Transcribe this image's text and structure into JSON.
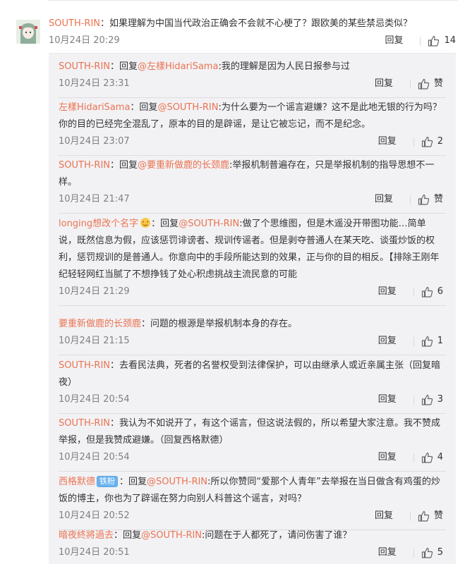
{
  "main_comment": {
    "user": "SOUTH-RIN",
    "text": "：如果理解为中国当代政治正确会不会就不心梗了？跟欧美的某些禁忌类似？",
    "time": "10月24日 20:29",
    "reply_label": "回复",
    "likes": "14"
  },
  "replies": [
    {
      "segments": [
        {
          "t": "SOUTH-RIN",
          "c": "user"
        },
        {
          "t": "：回复",
          "c": "text"
        },
        {
          "t": "@左樣HidariSama",
          "c": "user"
        },
        {
          "t": ":我的理解是因为人民日报参与过",
          "c": "text"
        }
      ],
      "time": "10月24日 23:31",
      "reply_label": "回复",
      "likes": "赞"
    },
    {
      "segments": [
        {
          "t": "左樣HidariSama",
          "c": "user"
        },
        {
          "t": "：回复",
          "c": "text"
        },
        {
          "t": "@SOUTH-RIN",
          "c": "user"
        },
        {
          "t": ":为什么要为一个谣言避嫌？这不是此地无银的行为吗？你的目的已经完全混乱了，原本的目的是辟谣，是让它被忘记，而不是纪念。",
          "c": "text"
        }
      ],
      "time": "10月24日 23:07",
      "reply_label": "回复",
      "likes": "2"
    },
    {
      "segments": [
        {
          "t": "SOUTH-RIN",
          "c": "user"
        },
        {
          "t": "：回复",
          "c": "text"
        },
        {
          "t": "@要重新做鹿的长颈鹿",
          "c": "user"
        },
        {
          "t": ":举报机制普遍存在，只是举报机制的指导思想不一样。",
          "c": "text"
        }
      ],
      "time": "10月24日 21:47",
      "reply_label": "回复",
      "likes": "赞"
    },
    {
      "segments": [
        {
          "t": "longing想改个名字",
          "c": "user"
        },
        {
          "t": "",
          "c": "emoji"
        },
        {
          "t": "：回复",
          "c": "text"
        },
        {
          "t": "@SOUTH-RIN",
          "c": "user"
        },
        {
          "t": ":做了个思维图，但是木遥没开带图功能…简单说，既然信息为假，应该惩罚诽谤者、规训传谣者。但是剥夺普通人在某天吃、谈蛋炒饭的权利，惩罚规训的是普通人。你意向中的手段所能达到的效果，正与你的目的相反。【排除王刚年纪轻轻网红当腻了不想挣钱了处心积虑挑战主流民意的可能",
          "c": "text"
        }
      ],
      "time": "10月24日 21:29",
      "reply_label": "回复",
      "likes": "6"
    },
    {
      "segments": [
        {
          "t": "要重新做鹿的长颈鹿",
          "c": "user"
        },
        {
          "t": "：问题的根源是举报机制本身的存在。",
          "c": "text"
        }
      ],
      "time": "10月24日 21:15",
      "reply_label": "回复",
      "likes": "1"
    },
    {
      "segments": [
        {
          "t": "SOUTH-RIN",
          "c": "user"
        },
        {
          "t": "：去看民法典，死者的名誉权受到法律保护，可以由继承人或近亲属主张（回复暗夜）",
          "c": "text"
        }
      ],
      "time": "10月24日 20:54",
      "reply_label": "回复",
      "likes": "3"
    },
    {
      "segments": [
        {
          "t": "SOUTH-RIN",
          "c": "user"
        },
        {
          "t": "：我认为不如说开了，有这个谣言，但这说法假的，所以希望大家注意。我不赞成举报，但是我赞成避嫌。（回复西格默德）",
          "c": "text"
        }
      ],
      "time": "10月24日 20:54",
      "reply_label": "回复",
      "likes": "4"
    },
    {
      "segments": [
        {
          "t": "西格默德",
          "c": "user"
        },
        {
          "t": "铁粉",
          "c": "fan"
        },
        {
          "t": "：回复",
          "c": "text"
        },
        {
          "t": "@SOUTH-RIN",
          "c": "user"
        },
        {
          "t": ":所以你赞同“爱那个人青年”去举报在当日做含有鸡蛋的炒饭的博主，你也为了辟谣在努力向别人科普这个谣言，对吗？",
          "c": "text"
        }
      ],
      "time": "10月24日 20:52",
      "reply_label": "回复",
      "likes": "赞"
    },
    {
      "segments": [
        {
          "t": "暗夜終將過去",
          "c": "user"
        },
        {
          "t": "：回复",
          "c": "text"
        },
        {
          "t": "@SOUTH-RIN",
          "c": "user"
        },
        {
          "t": ":问题在于人都死了，请问伤害了谁？",
          "c": "text"
        }
      ],
      "time": "10月24日 20:51",
      "reply_label": "回复",
      "likes": "5"
    }
  ]
}
